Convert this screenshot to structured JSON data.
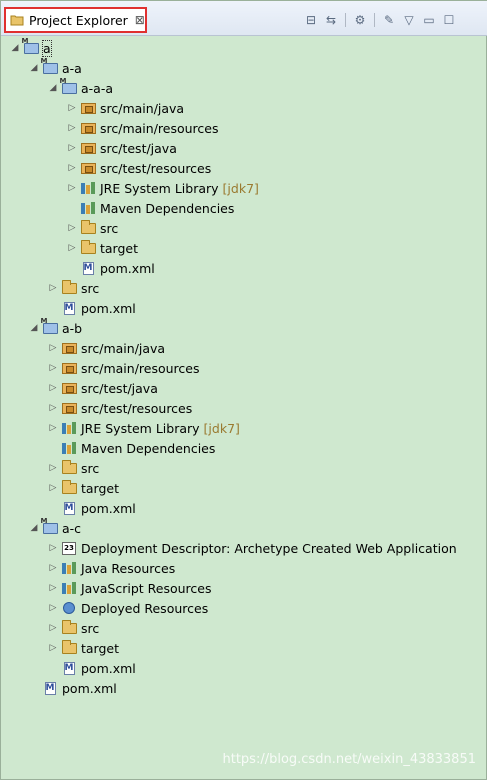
{
  "view": {
    "title": "Project Explorer",
    "close_glyph": "⊠"
  },
  "toolbar": [
    {
      "name": "collapse-all-icon",
      "glyph": "⊟"
    },
    {
      "name": "link-with-editor-icon",
      "glyph": "⇆"
    },
    {
      "name": "sep"
    },
    {
      "name": "filter-icon",
      "glyph": "⚙"
    },
    {
      "name": "sep"
    },
    {
      "name": "customize-icon",
      "glyph": "✎"
    },
    {
      "name": "view-menu-icon",
      "glyph": "▽"
    },
    {
      "name": "minimize-icon",
      "glyph": "▭"
    },
    {
      "name": "maximize-icon",
      "glyph": "☐"
    }
  ],
  "tree": [
    {
      "label": "a",
      "depth": 0,
      "state": "expanded",
      "icon": "project",
      "selected": true
    },
    {
      "label": "a-a",
      "depth": 1,
      "state": "expanded",
      "icon": "project"
    },
    {
      "label": "a-a-a",
      "depth": 2,
      "state": "expanded",
      "icon": "project"
    },
    {
      "label": "src/main/java",
      "depth": 3,
      "state": "collapsed",
      "icon": "pkgfolder"
    },
    {
      "label": "src/main/resources",
      "depth": 3,
      "state": "collapsed",
      "icon": "pkgfolder"
    },
    {
      "label": "src/test/java",
      "depth": 3,
      "state": "collapsed",
      "icon": "pkgfolder"
    },
    {
      "label": "src/test/resources",
      "depth": 3,
      "state": "collapsed",
      "icon": "pkgfolder"
    },
    {
      "label": "JRE System Library",
      "decoration": "[jdk7]",
      "depth": 3,
      "state": "collapsed",
      "icon": "lib"
    },
    {
      "label": "Maven Dependencies",
      "depth": 3,
      "state": "leaf",
      "icon": "lib"
    },
    {
      "label": "src",
      "depth": 3,
      "state": "collapsed",
      "icon": "folder"
    },
    {
      "label": "target",
      "depth": 3,
      "state": "collapsed",
      "icon": "folder"
    },
    {
      "label": "pom.xml",
      "depth": 3,
      "state": "leaf",
      "icon": "mfile"
    },
    {
      "label": "src",
      "depth": 2,
      "state": "collapsed",
      "icon": "folder"
    },
    {
      "label": "pom.xml",
      "depth": 2,
      "state": "leaf",
      "icon": "mfile"
    },
    {
      "label": "a-b",
      "depth": 1,
      "state": "expanded",
      "icon": "project"
    },
    {
      "label": "src/main/java",
      "depth": 2,
      "state": "collapsed",
      "icon": "pkgfolder"
    },
    {
      "label": "src/main/resources",
      "depth": 2,
      "state": "collapsed",
      "icon": "pkgfolder"
    },
    {
      "label": "src/test/java",
      "depth": 2,
      "state": "collapsed",
      "icon": "pkgfolder"
    },
    {
      "label": "src/test/resources",
      "depth": 2,
      "state": "collapsed",
      "icon": "pkgfolder"
    },
    {
      "label": "JRE System Library",
      "decoration": "[jdk7]",
      "depth": 2,
      "state": "collapsed",
      "icon": "lib"
    },
    {
      "label": "Maven Dependencies",
      "depth": 2,
      "state": "leaf",
      "icon": "lib"
    },
    {
      "label": "src",
      "depth": 2,
      "state": "collapsed",
      "icon": "folder"
    },
    {
      "label": "target",
      "depth": 2,
      "state": "collapsed",
      "icon": "folder"
    },
    {
      "label": "pom.xml",
      "depth": 2,
      "state": "leaf",
      "icon": "mfile"
    },
    {
      "label": "a-c",
      "depth": 1,
      "state": "expanded",
      "icon": "project"
    },
    {
      "label": "Deployment Descriptor: Archetype Created Web Application",
      "depth": 2,
      "state": "collapsed",
      "icon": "dd"
    },
    {
      "label": "Java Resources",
      "depth": 2,
      "state": "collapsed",
      "icon": "lib"
    },
    {
      "label": "JavaScript Resources",
      "depth": 2,
      "state": "collapsed",
      "icon": "lib"
    },
    {
      "label": "Deployed Resources",
      "depth": 2,
      "state": "collapsed",
      "icon": "globe"
    },
    {
      "label": "src",
      "depth": 2,
      "state": "collapsed",
      "icon": "folder"
    },
    {
      "label": "target",
      "depth": 2,
      "state": "collapsed",
      "icon": "folder"
    },
    {
      "label": "pom.xml",
      "depth": 2,
      "state": "leaf",
      "icon": "mfile"
    },
    {
      "label": "pom.xml",
      "depth": 1,
      "state": "leaf",
      "icon": "mfile"
    }
  ],
  "watermark": "https://blog.csdn.net/weixin_43833851"
}
